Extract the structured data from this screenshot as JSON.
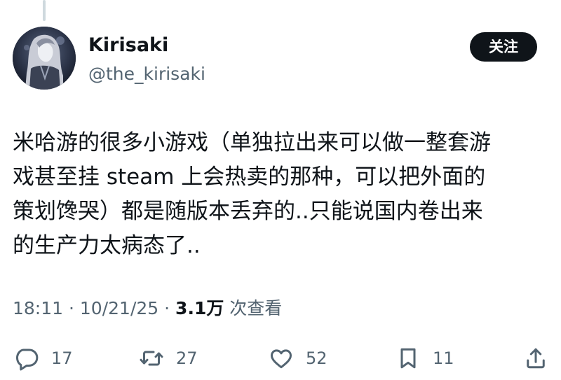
{
  "author": {
    "display_name": "Kirisaki",
    "handle": "@the_kirisaki",
    "avatar_icon": "anime-character-avatar"
  },
  "follow_button": {
    "label": "关注"
  },
  "tweet": {
    "lines": [
      "米哈游的很多小游戏（单独拉出来可以做一整套游",
      "戏甚至挂 steam 上会热卖的那种，可以把外面的",
      "策划馋哭）都是随版本丢弃的..只能说国内卷出来",
      "的生产力太病态了.."
    ]
  },
  "meta": {
    "time": "18:11",
    "separator": "·",
    "date": "10/21/25",
    "views_count": "3.1万",
    "views_label": "次查看"
  },
  "actions": {
    "reply": {
      "icon": "reply-icon",
      "count": "17"
    },
    "repost": {
      "icon": "repost-icon",
      "count": "27"
    },
    "like": {
      "icon": "heart-icon",
      "count": "52"
    },
    "bookmark": {
      "icon": "bookmark-icon",
      "count": "11"
    },
    "share": {
      "icon": "share-icon"
    }
  },
  "colors": {
    "text_primary": "#0f1419",
    "text_secondary": "#536471",
    "button_bg": "#0f1419",
    "thread_line": "#cfd9de"
  }
}
